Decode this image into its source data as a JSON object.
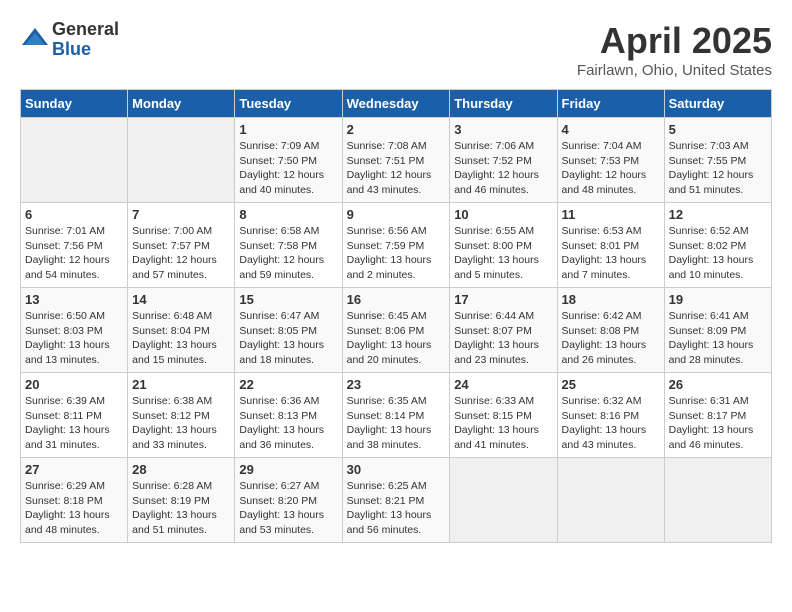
{
  "header": {
    "logo_general": "General",
    "logo_blue": "Blue",
    "title": "April 2025",
    "location": "Fairlawn, Ohio, United States"
  },
  "weekdays": [
    "Sunday",
    "Monday",
    "Tuesday",
    "Wednesday",
    "Thursday",
    "Friday",
    "Saturday"
  ],
  "weeks": [
    [
      {
        "day": "",
        "info": ""
      },
      {
        "day": "",
        "info": ""
      },
      {
        "day": "1",
        "info": "Sunrise: 7:09 AM\nSunset: 7:50 PM\nDaylight: 12 hours\nand 40 minutes."
      },
      {
        "day": "2",
        "info": "Sunrise: 7:08 AM\nSunset: 7:51 PM\nDaylight: 12 hours\nand 43 minutes."
      },
      {
        "day": "3",
        "info": "Sunrise: 7:06 AM\nSunset: 7:52 PM\nDaylight: 12 hours\nand 46 minutes."
      },
      {
        "day": "4",
        "info": "Sunrise: 7:04 AM\nSunset: 7:53 PM\nDaylight: 12 hours\nand 48 minutes."
      },
      {
        "day": "5",
        "info": "Sunrise: 7:03 AM\nSunset: 7:55 PM\nDaylight: 12 hours\nand 51 minutes."
      }
    ],
    [
      {
        "day": "6",
        "info": "Sunrise: 7:01 AM\nSunset: 7:56 PM\nDaylight: 12 hours\nand 54 minutes."
      },
      {
        "day": "7",
        "info": "Sunrise: 7:00 AM\nSunset: 7:57 PM\nDaylight: 12 hours\nand 57 minutes."
      },
      {
        "day": "8",
        "info": "Sunrise: 6:58 AM\nSunset: 7:58 PM\nDaylight: 12 hours\nand 59 minutes."
      },
      {
        "day": "9",
        "info": "Sunrise: 6:56 AM\nSunset: 7:59 PM\nDaylight: 13 hours\nand 2 minutes."
      },
      {
        "day": "10",
        "info": "Sunrise: 6:55 AM\nSunset: 8:00 PM\nDaylight: 13 hours\nand 5 minutes."
      },
      {
        "day": "11",
        "info": "Sunrise: 6:53 AM\nSunset: 8:01 PM\nDaylight: 13 hours\nand 7 minutes."
      },
      {
        "day": "12",
        "info": "Sunrise: 6:52 AM\nSunset: 8:02 PM\nDaylight: 13 hours\nand 10 minutes."
      }
    ],
    [
      {
        "day": "13",
        "info": "Sunrise: 6:50 AM\nSunset: 8:03 PM\nDaylight: 13 hours\nand 13 minutes."
      },
      {
        "day": "14",
        "info": "Sunrise: 6:48 AM\nSunset: 8:04 PM\nDaylight: 13 hours\nand 15 minutes."
      },
      {
        "day": "15",
        "info": "Sunrise: 6:47 AM\nSunset: 8:05 PM\nDaylight: 13 hours\nand 18 minutes."
      },
      {
        "day": "16",
        "info": "Sunrise: 6:45 AM\nSunset: 8:06 PM\nDaylight: 13 hours\nand 20 minutes."
      },
      {
        "day": "17",
        "info": "Sunrise: 6:44 AM\nSunset: 8:07 PM\nDaylight: 13 hours\nand 23 minutes."
      },
      {
        "day": "18",
        "info": "Sunrise: 6:42 AM\nSunset: 8:08 PM\nDaylight: 13 hours\nand 26 minutes."
      },
      {
        "day": "19",
        "info": "Sunrise: 6:41 AM\nSunset: 8:09 PM\nDaylight: 13 hours\nand 28 minutes."
      }
    ],
    [
      {
        "day": "20",
        "info": "Sunrise: 6:39 AM\nSunset: 8:11 PM\nDaylight: 13 hours\nand 31 minutes."
      },
      {
        "day": "21",
        "info": "Sunrise: 6:38 AM\nSunset: 8:12 PM\nDaylight: 13 hours\nand 33 minutes."
      },
      {
        "day": "22",
        "info": "Sunrise: 6:36 AM\nSunset: 8:13 PM\nDaylight: 13 hours\nand 36 minutes."
      },
      {
        "day": "23",
        "info": "Sunrise: 6:35 AM\nSunset: 8:14 PM\nDaylight: 13 hours\nand 38 minutes."
      },
      {
        "day": "24",
        "info": "Sunrise: 6:33 AM\nSunset: 8:15 PM\nDaylight: 13 hours\nand 41 minutes."
      },
      {
        "day": "25",
        "info": "Sunrise: 6:32 AM\nSunset: 8:16 PM\nDaylight: 13 hours\nand 43 minutes."
      },
      {
        "day": "26",
        "info": "Sunrise: 6:31 AM\nSunset: 8:17 PM\nDaylight: 13 hours\nand 46 minutes."
      }
    ],
    [
      {
        "day": "27",
        "info": "Sunrise: 6:29 AM\nSunset: 8:18 PM\nDaylight: 13 hours\nand 48 minutes."
      },
      {
        "day": "28",
        "info": "Sunrise: 6:28 AM\nSunset: 8:19 PM\nDaylight: 13 hours\nand 51 minutes."
      },
      {
        "day": "29",
        "info": "Sunrise: 6:27 AM\nSunset: 8:20 PM\nDaylight: 13 hours\nand 53 minutes."
      },
      {
        "day": "30",
        "info": "Sunrise: 6:25 AM\nSunset: 8:21 PM\nDaylight: 13 hours\nand 56 minutes."
      },
      {
        "day": "",
        "info": ""
      },
      {
        "day": "",
        "info": ""
      },
      {
        "day": "",
        "info": ""
      }
    ]
  ]
}
